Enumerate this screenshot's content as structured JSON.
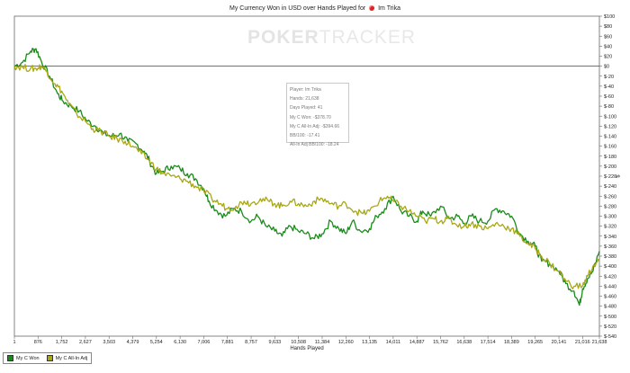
{
  "chart_data": {
    "type": "line",
    "title_prefix": "My Currency Won in USD over Hands Played for",
    "title_player": "Im Trika",
    "xlabel": "Hands Played",
    "ylabel": "$",
    "x_ticks": [
      1,
      876,
      1752,
      2627,
      3503,
      4379,
      5254,
      6130,
      7006,
      7881,
      8757,
      9633,
      10508,
      11384,
      12260,
      13135,
      14011,
      14887,
      15762,
      16638,
      17514,
      18389,
      19265,
      20141,
      21016,
      21638
    ],
    "x_tick_labels": [
      "1",
      "876",
      "1,752",
      "2,627",
      "3,503",
      "4,379",
      "5,254",
      "6,130",
      "7,006",
      "7,881",
      "8,757",
      "9,633",
      "10,508",
      "11,384",
      "12,260",
      "13,135",
      "14,011",
      "14,887",
      "15,762",
      "16,638",
      "17,514",
      "18,389",
      "19,265",
      "20,141",
      "21,016",
      "21,638"
    ],
    "xlim": [
      1,
      21638
    ],
    "ylim": [
      -540,
      100
    ],
    "y_ticks": [
      100,
      80,
      60,
      40,
      20,
      0,
      -20,
      -40,
      -60,
      -80,
      -100,
      -120,
      -140,
      -160,
      -180,
      -200,
      -220,
      -240,
      -260,
      -280,
      -300,
      -320,
      -340,
      -360,
      -380,
      -400,
      -420,
      -440,
      -460,
      -480,
      -500,
      -520,
      -540
    ],
    "y_tick_labels": [
      "$100",
      "$80",
      "$60",
      "$40",
      "$20",
      "$0",
      "$-20",
      "$-40",
      "$-60",
      "$-80",
      "$-100",
      "$-120",
      "$-140",
      "$-160",
      "$-180",
      "$-200",
      "$-220",
      "$-240",
      "$-260",
      "$-280",
      "$-300",
      "$-320",
      "$-340",
      "$-360",
      "$-380",
      "$-400",
      "$-420",
      "$-440",
      "$-460",
      "$-480",
      "$-500",
      "$-520",
      "$-540"
    ],
    "grid": false,
    "zero_line": true,
    "legend_position": "bottom-left",
    "series": [
      {
        "name": "My C Won",
        "color": "#1a8a1a",
        "points": [
          [
            1,
            0
          ],
          [
            300,
            8
          ],
          [
            600,
            30
          ],
          [
            800,
            35
          ],
          [
            1000,
            10
          ],
          [
            1300,
            -20
          ],
          [
            1600,
            -55
          ],
          [
            1800,
            -70
          ],
          [
            2100,
            -80
          ],
          [
            2400,
            -90
          ],
          [
            2700,
            -110
          ],
          [
            3000,
            -120
          ],
          [
            3300,
            -135
          ],
          [
            3600,
            -140
          ],
          [
            3900,
            -135
          ],
          [
            4200,
            -150
          ],
          [
            4500,
            -155
          ],
          [
            4800,
            -170
          ],
          [
            5000,
            -190
          ],
          [
            5254,
            -215
          ],
          [
            5500,
            -210
          ],
          [
            5800,
            -200
          ],
          [
            6130,
            -205
          ],
          [
            6400,
            -215
          ],
          [
            6700,
            -225
          ],
          [
            7006,
            -245
          ],
          [
            7200,
            -270
          ],
          [
            7500,
            -290
          ],
          [
            7800,
            -300
          ],
          [
            8100,
            -285
          ],
          [
            8400,
            -290
          ],
          [
            8757,
            -310
          ],
          [
            9000,
            -300
          ],
          [
            9300,
            -320
          ],
          [
            9633,
            -330
          ],
          [
            9900,
            -340
          ],
          [
            10200,
            -320
          ],
          [
            10508,
            -330
          ],
          [
            10800,
            -335
          ],
          [
            11100,
            -345
          ],
          [
            11384,
            -335
          ],
          [
            11700,
            -310
          ],
          [
            12000,
            -325
          ],
          [
            12260,
            -335
          ],
          [
            12500,
            -310
          ],
          [
            12800,
            -330
          ],
          [
            13135,
            -325
          ],
          [
            13400,
            -300
          ],
          [
            13700,
            -285
          ],
          [
            14011,
            -260
          ],
          [
            14300,
            -290
          ],
          [
            14600,
            -300
          ],
          [
            14887,
            -310
          ],
          [
            15100,
            -290
          ],
          [
            15400,
            -300
          ],
          [
            15762,
            -280
          ],
          [
            16100,
            -305
          ],
          [
            16400,
            -300
          ],
          [
            16638,
            -315
          ],
          [
            16900,
            -300
          ],
          [
            17200,
            -310
          ],
          [
            17514,
            -310
          ],
          [
            17800,
            -285
          ],
          [
            18100,
            -290
          ],
          [
            18389,
            -300
          ],
          [
            18700,
            -335
          ],
          [
            19000,
            -350
          ],
          [
            19265,
            -360
          ],
          [
            19500,
            -390
          ],
          [
            19800,
            -395
          ],
          [
            20141,
            -410
          ],
          [
            20400,
            -435
          ],
          [
            20700,
            -450
          ],
          [
            20900,
            -478
          ],
          [
            21016,
            -445
          ],
          [
            21200,
            -425
          ],
          [
            21400,
            -410
          ],
          [
            21638,
            -370
          ]
        ]
      },
      {
        "name": "My C All-In Adj",
        "color": "#a8a812",
        "points": [
          [
            1,
            0
          ],
          [
            300,
            -2
          ],
          [
            600,
            -5
          ],
          [
            800,
            -5
          ],
          [
            1000,
            0
          ],
          [
            1200,
            -10
          ],
          [
            1500,
            -35
          ],
          [
            1752,
            -50
          ],
          [
            2000,
            -75
          ],
          [
            2300,
            -95
          ],
          [
            2627,
            -110
          ],
          [
            2900,
            -125
          ],
          [
            3200,
            -130
          ],
          [
            3503,
            -140
          ],
          [
            3800,
            -145
          ],
          [
            4100,
            -150
          ],
          [
            4379,
            -160
          ],
          [
            4700,
            -175
          ],
          [
            5000,
            -190
          ],
          [
            5254,
            -205
          ],
          [
            5500,
            -215
          ],
          [
            5800,
            -220
          ],
          [
            6130,
            -225
          ],
          [
            6400,
            -230
          ],
          [
            6700,
            -240
          ],
          [
            7006,
            -250
          ],
          [
            7300,
            -265
          ],
          [
            7600,
            -275
          ],
          [
            7881,
            -285
          ],
          [
            8200,
            -280
          ],
          [
            8500,
            -270
          ],
          [
            8757,
            -275
          ],
          [
            9100,
            -265
          ],
          [
            9400,
            -270
          ],
          [
            9633,
            -275
          ],
          [
            9900,
            -280
          ],
          [
            10200,
            -270
          ],
          [
            10508,
            -275
          ],
          [
            10800,
            -280
          ],
          [
            11100,
            -270
          ],
          [
            11384,
            -265
          ],
          [
            11700,
            -275
          ],
          [
            12000,
            -280
          ],
          [
            12260,
            -275
          ],
          [
            12600,
            -290
          ],
          [
            12900,
            -295
          ],
          [
            13135,
            -290
          ],
          [
            13500,
            -270
          ],
          [
            13800,
            -260
          ],
          [
            14011,
            -270
          ],
          [
            14300,
            -280
          ],
          [
            14600,
            -290
          ],
          [
            14887,
            -300
          ],
          [
            15200,
            -310
          ],
          [
            15500,
            -305
          ],
          [
            15762,
            -310
          ],
          [
            16000,
            -305
          ],
          [
            16300,
            -315
          ],
          [
            16638,
            -320
          ],
          [
            16900,
            -315
          ],
          [
            17200,
            -320
          ],
          [
            17514,
            -325
          ],
          [
            17800,
            -315
          ],
          [
            18100,
            -320
          ],
          [
            18389,
            -325
          ],
          [
            18700,
            -340
          ],
          [
            19000,
            -355
          ],
          [
            19265,
            -365
          ],
          [
            19500,
            -380
          ],
          [
            19800,
            -395
          ],
          [
            20141,
            -410
          ],
          [
            20400,
            -430
          ],
          [
            20700,
            -440
          ],
          [
            21016,
            -440
          ],
          [
            21200,
            -420
          ],
          [
            21400,
            -400
          ],
          [
            21638,
            -390
          ]
        ]
      }
    ]
  },
  "info_box": {
    "player": "Player: Im Trika",
    "hands": "Hands: 21,638",
    "days": "Days Played: 41",
    "won": "My C Won: -$378.70",
    "allin": "My C All-In Adj: -$394.66",
    "bb100": "BB/100: -17.41",
    "allin_bb100": "All-In Adj BB/100: -18.24"
  },
  "watermark": {
    "bold": "POKER",
    "thin": "TRACKER"
  }
}
